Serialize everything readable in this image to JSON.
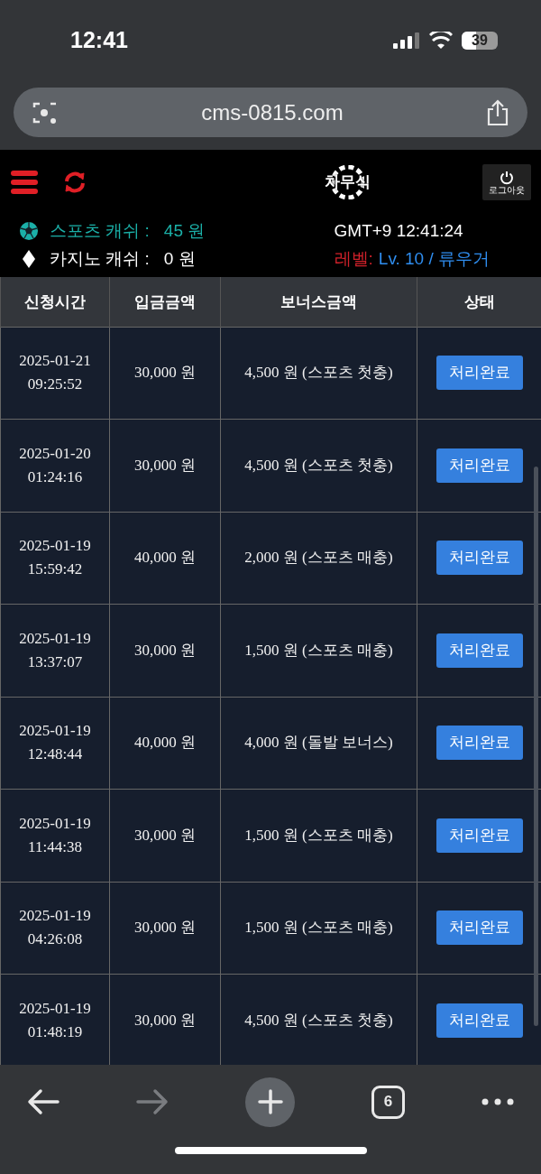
{
  "status_bar": {
    "time": "12:41",
    "battery": "39"
  },
  "browser": {
    "url": "cms-0815.com",
    "tab_count": "6"
  },
  "header": {
    "logo": "차무식",
    "logout": "로그아웃"
  },
  "account": {
    "sports_label": "스포츠 캐쉬 :",
    "sports_value": "45 원",
    "casino_label": "카지노 캐쉬 :",
    "casino_value": "0 원",
    "clock": "GMT+9 12:41:24",
    "level_label": "레벨:",
    "level_value": "Lv. 10 / 류우거"
  },
  "table": {
    "columns": [
      "신청시간",
      "입금금액",
      "보너스금액",
      "상태"
    ],
    "rows": [
      {
        "date": "2025-01-21",
        "time": "09:25:52",
        "deposit": "30,000 원",
        "bonus": "4,500 원 (스포츠 첫충)",
        "status": "처리완료"
      },
      {
        "date": "2025-01-20",
        "time": "01:24:16",
        "deposit": "30,000 원",
        "bonus": "4,500 원 (스포츠 첫충)",
        "status": "처리완료"
      },
      {
        "date": "2025-01-19",
        "time": "15:59:42",
        "deposit": "40,000 원",
        "bonus": "2,000 원 (스포츠 매충)",
        "status": "처리완료"
      },
      {
        "date": "2025-01-19",
        "time": "13:37:07",
        "deposit": "30,000 원",
        "bonus": "1,500 원 (스포츠 매충)",
        "status": "처리완료"
      },
      {
        "date": "2025-01-19",
        "time": "12:48:44",
        "deposit": "40,000 원",
        "bonus": "4,000 원 (돌발 보너스)",
        "status": "처리완료"
      },
      {
        "date": "2025-01-19",
        "time": "11:44:38",
        "deposit": "30,000 원",
        "bonus": "1,500 원 (스포츠 매충)",
        "status": "처리완료"
      },
      {
        "date": "2025-01-19",
        "time": "04:26:08",
        "deposit": "30,000 원",
        "bonus": "1,500 원 (스포츠 매충)",
        "status": "처리완료"
      },
      {
        "date": "2025-01-19",
        "time": "01:48:19",
        "deposit": "30,000 원",
        "bonus": "4,500 원 (스포츠 첫충)",
        "status": "처리완료"
      }
    ]
  }
}
